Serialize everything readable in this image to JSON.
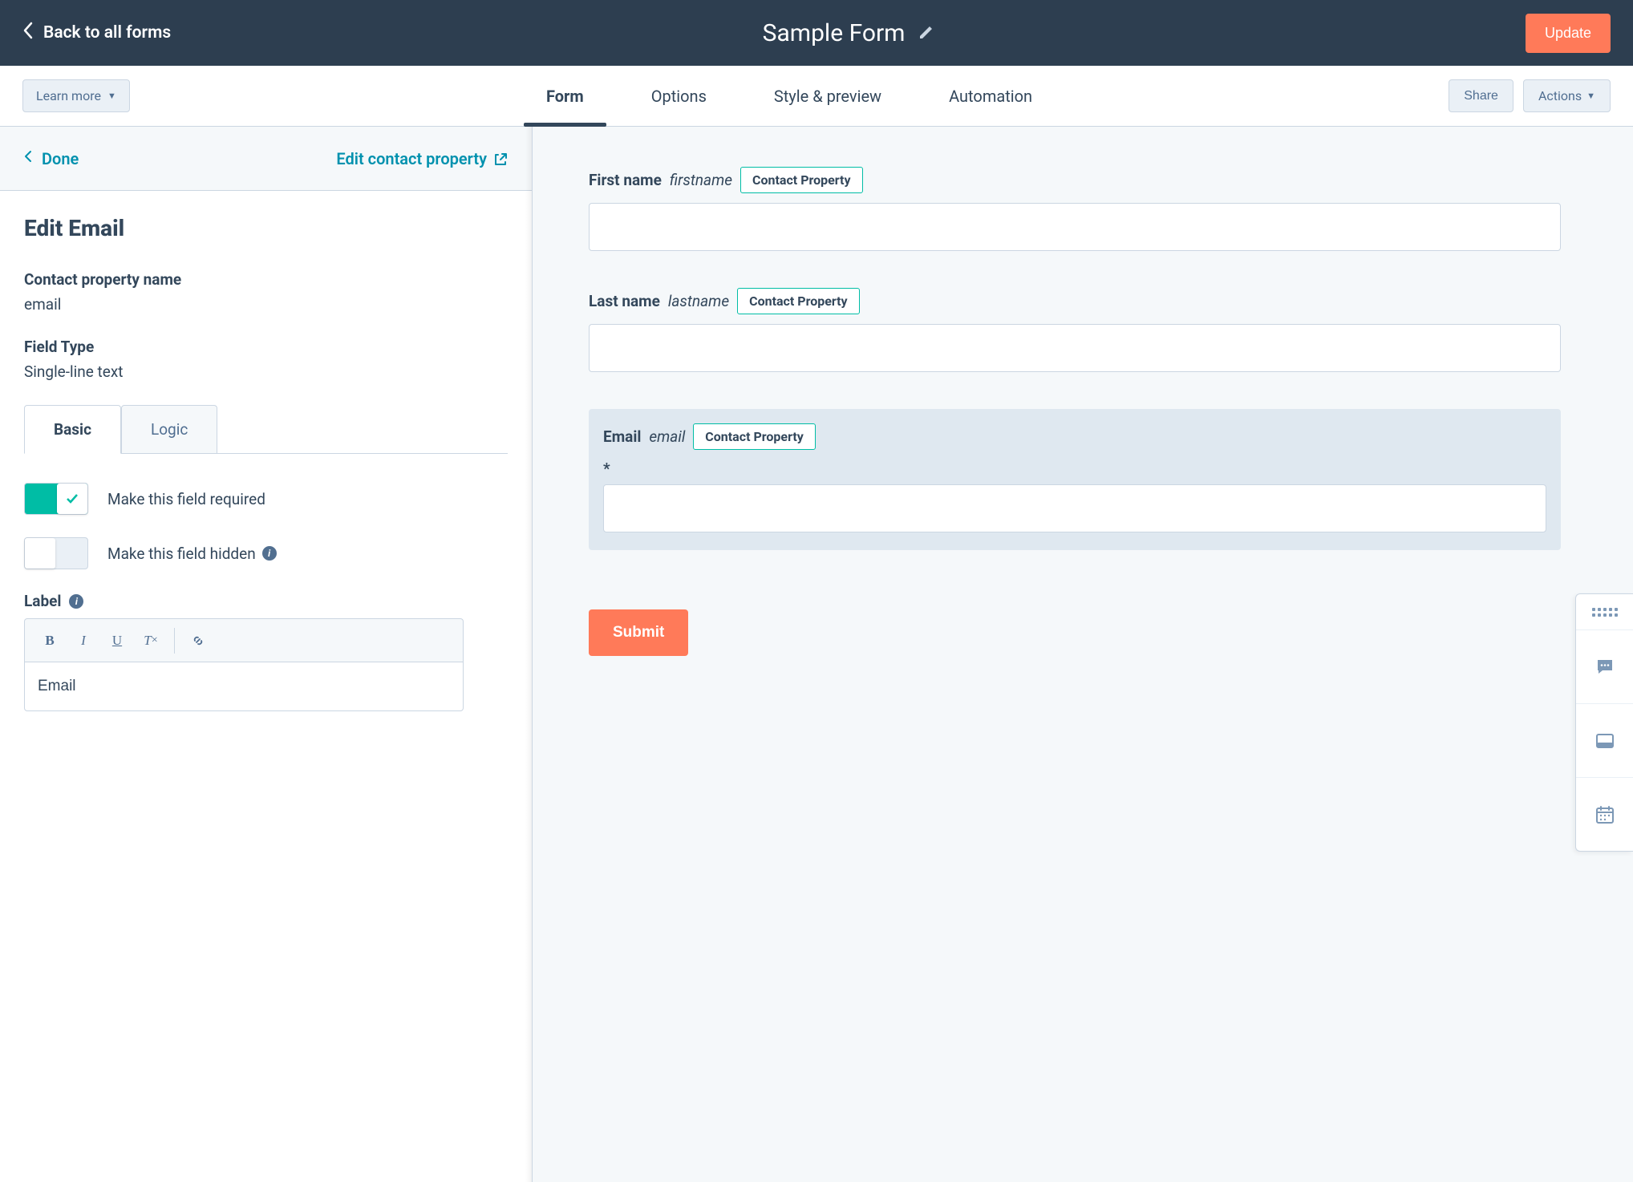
{
  "header": {
    "back": "Back to all forms",
    "title": "Sample Form",
    "update": "Update"
  },
  "subnav": {
    "learn_more": "Learn more",
    "tabs": [
      "Form",
      "Options",
      "Style & preview",
      "Automation"
    ],
    "share": "Share",
    "actions": "Actions"
  },
  "panel": {
    "done": "Done",
    "edit_prop": "Edit contact property",
    "title": "Edit Email",
    "prop_name_label": "Contact property name",
    "prop_name_value": "email",
    "field_type_label": "Field Type",
    "field_type_value": "Single-line text",
    "tabs": {
      "basic": "Basic",
      "logic": "Logic"
    },
    "required_label": "Make this field required",
    "hidden_label": "Make this field hidden",
    "label_label": "Label",
    "label_value": "Email"
  },
  "canvas": {
    "fields": [
      {
        "label": "First name",
        "name": "firstname",
        "badge": "Contact Property"
      },
      {
        "label": "Last name",
        "name": "lastname",
        "badge": "Contact Property"
      },
      {
        "label": "Email",
        "name": "email",
        "badge": "Contact Property",
        "required": "*"
      }
    ],
    "submit": "Submit"
  }
}
